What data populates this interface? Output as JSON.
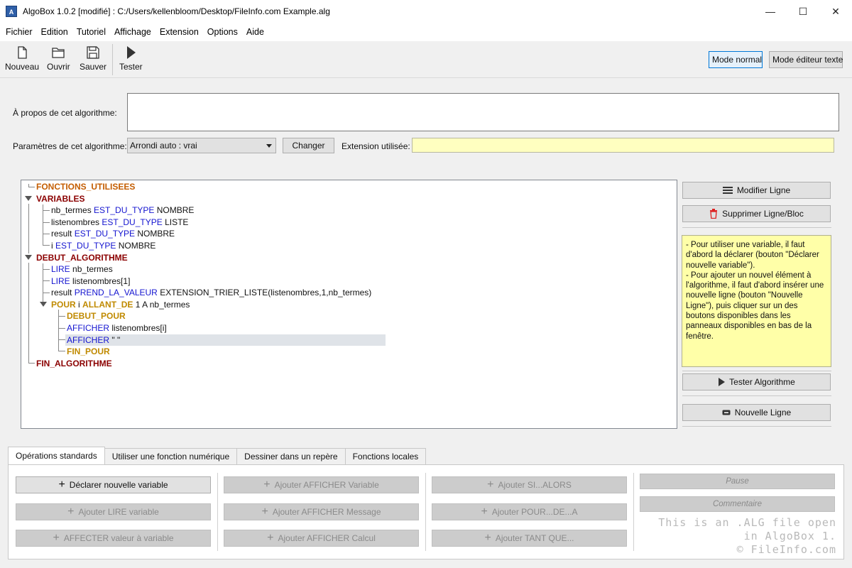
{
  "window": {
    "icon_text": "A",
    "title": "AlgoBox 1.0.2 [modifié] : C:/Users/kellenbloom/Desktop/FileInfo.com Example.alg",
    "minimize": "—",
    "maximize": "☐",
    "close": "✕"
  },
  "menu": [
    "Fichier",
    "Edition",
    "Tutoriel",
    "Affichage",
    "Extension",
    "Options",
    "Aide"
  ],
  "toolbar": {
    "nouveau": "Nouveau",
    "ouvrir": "Ouvrir",
    "sauver": "Sauver",
    "tester": "Tester",
    "mode_normal": "Mode normal",
    "mode_editeur": "Mode éditeur texte"
  },
  "params": {
    "about_label": "À propos de cet algorithme:",
    "about_value": "",
    "params_label": "Paramètres de cet algorithme:",
    "combo_value": "Arrondi auto : vrai",
    "changer": "Changer",
    "extension_label": "Extension utilisée:",
    "extension_value": ""
  },
  "tree": {
    "fonctions": "FONCTIONS_UTILISEES",
    "variables": "VARIABLES",
    "var1_name": "nb_termes",
    "var2_name": "listenombres",
    "var3_name": "result",
    "var4_name": "i",
    "est_du_type": "EST_DU_TYPE",
    "type_nombre": "NOMBRE",
    "type_liste": "LISTE",
    "debut_algo": "DEBUT_ALGORITHME",
    "lire": "LIRE",
    "lire1_arg": "nb_termes",
    "lire2_arg": "listenombres[1]",
    "result": "result",
    "prend_la_valeur": "PREND_LA_VALEUR",
    "trier_expr": "EXTENSION_TRIER_LISTE(listenombres,1,nb_termes)",
    "pour": "POUR",
    "pour_var": "i",
    "allant_de": "ALLANT_DE",
    "pour_range": "1 A nb_termes",
    "debut_pour": "DEBUT_POUR",
    "afficher": "AFFICHER",
    "afficher1_arg": "listenombres[i]",
    "afficher2_arg": "\" \"",
    "fin_pour": "FIN_POUR",
    "fin_algo": "FIN_ALGORITHME"
  },
  "side": {
    "modifier": "Modifier Ligne",
    "supprimer": "Supprimer Ligne/Bloc",
    "help_text": "- Pour utiliser une variable, il faut d'abord la déclarer (bouton \"Déclarer nouvelle variable\").\n- Pour ajouter un nouvel élément à l'algorithme, il faut d'abord insérer une nouvelle ligne (bouton \"Nouvelle Ligne\"), puis cliquer sur un des boutons disponibles dans les panneaux disponibles en bas de la fenêtre.",
    "tester": "Tester Algorithme",
    "nouvelle": "Nouvelle Ligne"
  },
  "tabs": [
    "Opérations standards",
    "Utiliser une fonction numérique",
    "Dessiner dans un repère",
    "Fonctions locales"
  ],
  "ops": {
    "declarer": "Déclarer nouvelle variable",
    "lire": "Ajouter LIRE variable",
    "affecter": "AFFECTER valeur à variable",
    "aff_var": "Ajouter AFFICHER Variable",
    "aff_msg": "Ajouter AFFICHER Message",
    "aff_calc": "Ajouter AFFICHER Calcul",
    "si": "Ajouter SI...ALORS",
    "pour": "Ajouter POUR...DE...A",
    "tantque": "Ajouter TANT QUE...",
    "pause": "Pause",
    "commentaire": "Commentaire"
  },
  "watermark": "This is an .ALG file open\nin AlgoBox 1.\n© FileInfo.com"
}
